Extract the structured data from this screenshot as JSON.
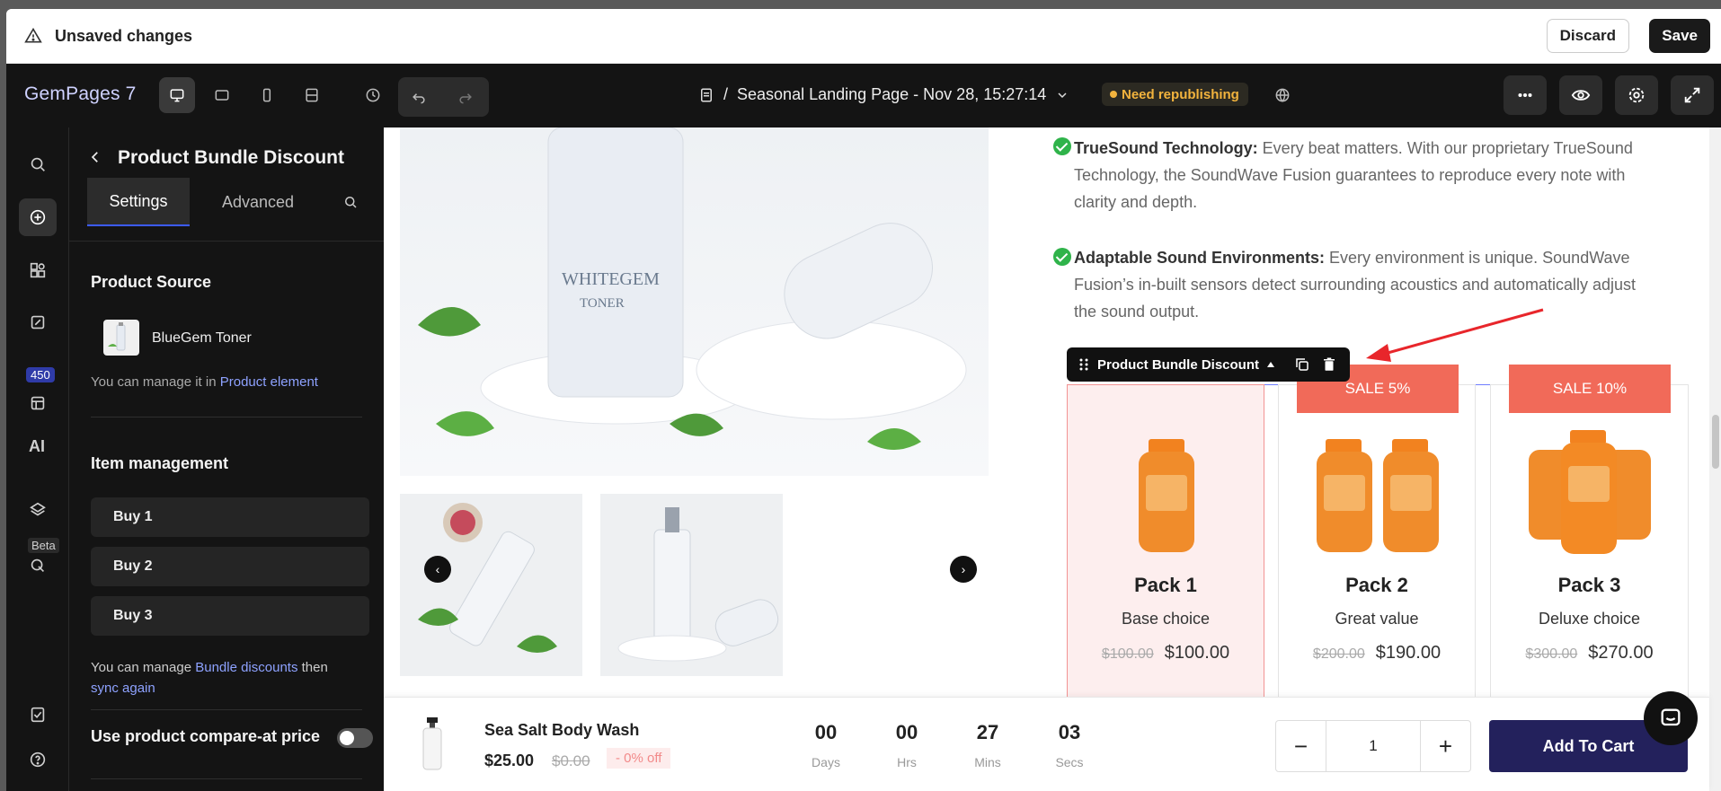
{
  "notice": {
    "message": "Unsaved changes",
    "discard_label": "Discard",
    "save_label": "Save"
  },
  "toolbar": {
    "brand": "GemPages 7",
    "page_path_prefix": "/",
    "page_name": "Seasonal Landing Page - Nov 28, 15:27:14",
    "status_badge": "Need republishing",
    "icons": [
      "desktop-icon",
      "tablet-icon",
      "mobile-icon",
      "responsive-icon",
      "history-icon",
      "undo-icon",
      "redo-icon",
      "more-icon",
      "preview-icon",
      "settings-icon",
      "fullscreen-icon"
    ]
  },
  "rail": {
    "badge_count": "450",
    "ai_label": "AI",
    "beta_label": "Beta"
  },
  "panel": {
    "title": "Product Bundle Discount",
    "tabs": [
      "Settings",
      "Advanced"
    ],
    "product_source_heading": "Product Source",
    "product_name": "BlueGem Toner",
    "manage_note_prefix": "You can manage it in",
    "manage_note_link": "Product element",
    "item_mgmt_heading": "Item management",
    "items": [
      "Buy 1",
      "Buy 2",
      "Buy 3"
    ],
    "bundle_note_prefix": "You can manage",
    "bundle_note_link": "Bundle discounts",
    "bundle_note_mid": "then",
    "bundle_note_link2": "sync again",
    "compare_label": "Use product compare-at price",
    "compare_enabled": false
  },
  "canvas": {
    "features": [
      {
        "title": "TrueSound Technology:",
        "text": " Every beat matters. With our proprietary TrueSound Technology, the SoundWave Fusion guarantees to reproduce every note with clarity and depth."
      },
      {
        "title": "Adaptable Sound Environments:",
        "text": " Every environment is unique. SoundWave Fusion’s in-built sensors detect surrounding acoustics and automatically adjust the sound output."
      }
    ],
    "image_label_1": "WHITEGEM",
    "image_label_2": "TONER",
    "widget_tag": "Product Bundle Discount",
    "packs": [
      {
        "title": "Pack 1",
        "subtitle": "Base choice",
        "compare_price": "$100.00",
        "price": "$100.00",
        "sale": ""
      },
      {
        "title": "Pack 2",
        "subtitle": "Great value",
        "compare_price": "$200.00",
        "price": "$190.00",
        "sale": "SALE 5%"
      },
      {
        "title": "Pack 3",
        "subtitle": "Deluxe choice",
        "compare_price": "$300.00",
        "price": "$270.00",
        "sale": "SALE 10%"
      }
    ]
  },
  "sticky": {
    "product_name": "Sea Salt Body Wash",
    "price": "$25.00",
    "compare_price": "$0.00",
    "discount": "- 0% off",
    "countdown": [
      {
        "value": "00",
        "label": "Days"
      },
      {
        "value": "00",
        "label": "Hrs"
      },
      {
        "value": "27",
        "label": "Mins"
      },
      {
        "value": "03",
        "label": "Secs"
      }
    ],
    "quantity": "1",
    "add_to_cart": "Add To Cart"
  },
  "colors": {
    "accent": "#3c5bff",
    "sale": "#f16a59",
    "badge": "#f2b33d",
    "cart": "#23215c"
  }
}
